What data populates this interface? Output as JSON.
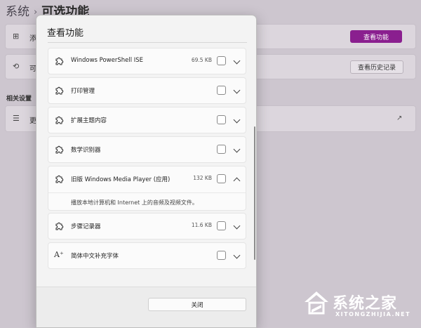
{
  "background": {
    "breadcrumb_parent": "系统",
    "breadcrumb_separator": "›",
    "breadcrumb_current": "可选功能",
    "row1": {
      "text": "添",
      "button": "查看功能"
    },
    "row2": {
      "text": "可",
      "button": "查看历史记录"
    },
    "section_label": "相关设置",
    "row3": {
      "text": "更"
    },
    "accent_color": "#8a1f8f"
  },
  "dialog": {
    "title": "查看功能",
    "items": [
      {
        "icon": "puzzle-icon",
        "name": "Windows PowerShell ISE",
        "size": "69.5 KB",
        "checked": false,
        "expanded": false
      },
      {
        "icon": "puzzle-icon",
        "name": "打印管理",
        "size": "",
        "checked": false,
        "expanded": false
      },
      {
        "icon": "puzzle-icon",
        "name": "扩展主题内容",
        "size": "",
        "checked": false,
        "expanded": false
      },
      {
        "icon": "puzzle-icon",
        "name": "数学识别器",
        "size": "",
        "checked": false,
        "expanded": false
      },
      {
        "icon": "puzzle-icon",
        "name": "旧版 Windows Media Player (应用)",
        "size": "132 KB",
        "checked": false,
        "expanded": true,
        "description": "播放本地计算机和 Internet 上的音频及视频文件。"
      },
      {
        "icon": "puzzle-icon",
        "name": "步骤记录器",
        "size": "11.6 KB",
        "checked": false,
        "expanded": false
      },
      {
        "icon": "font-icon",
        "name": "简体中文补充字体",
        "size": "",
        "checked": false,
        "expanded": false
      }
    ],
    "close_label": "关闭"
  },
  "watermark": {
    "text": "系统之家",
    "sub": "XITONGZHIJIA.NET"
  }
}
